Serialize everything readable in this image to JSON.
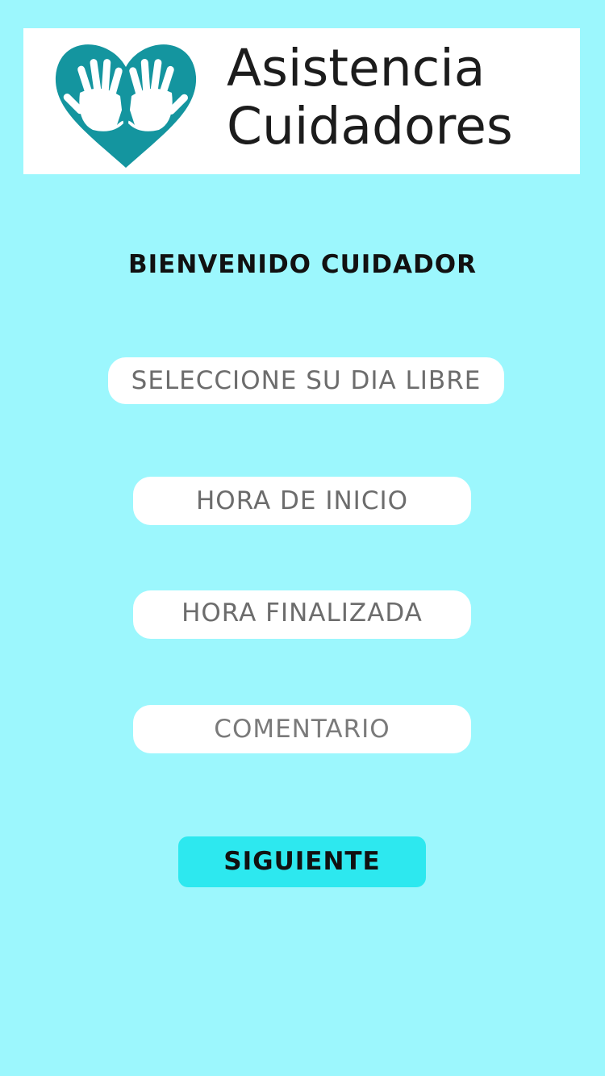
{
  "logo": {
    "line1": "Asistencia",
    "line2": "Cuidadores",
    "icon": "heart-hands-icon",
    "icon_color": "#14959f"
  },
  "welcome_text": "BIENVENIDO CUIDADOR",
  "form": {
    "day_field": "SELECCIONE SU DIA LIBRE",
    "start_field": "HORA DE INICIO",
    "end_field": "HORA FINALIZADA",
    "comment_field": "COMENTARIO"
  },
  "next_button": "SIGUIENTE",
  "colors": {
    "background": "#9cf7fd",
    "button": "#2de8ef",
    "field": "#ffffff"
  }
}
